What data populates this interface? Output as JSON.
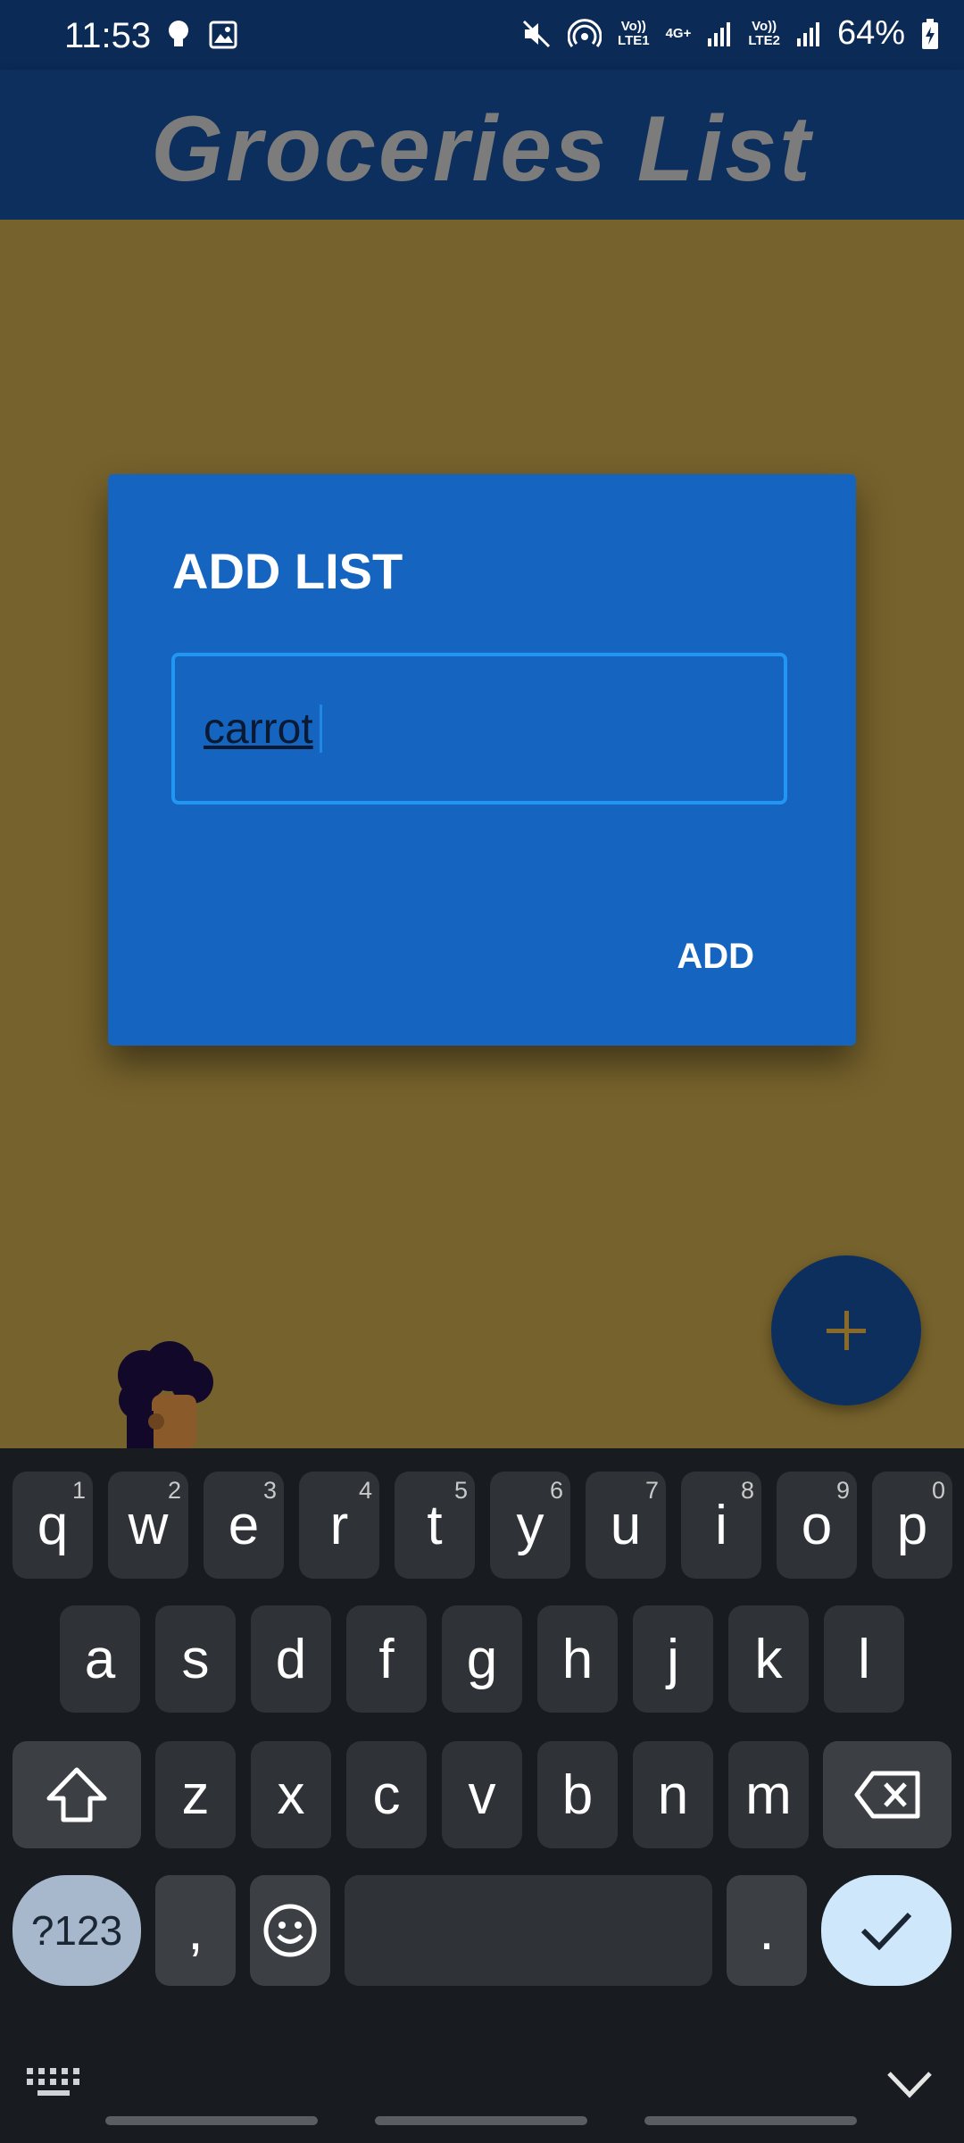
{
  "status_bar": {
    "time": "11:53",
    "net1_top": "Vo))",
    "net1_bottom": "LTE1",
    "net_type": "4G+",
    "net2_top": "Vo))",
    "net2_bottom": "LTE2",
    "battery": "64%"
  },
  "app": {
    "title": "Groceries List"
  },
  "dialog": {
    "title": "ADD LIST",
    "input_value": "carrot",
    "action_label": "ADD"
  },
  "keyboard": {
    "row1": [
      {
        "k": "q",
        "n": "1"
      },
      {
        "k": "w",
        "n": "2"
      },
      {
        "k": "e",
        "n": "3"
      },
      {
        "k": "r",
        "n": "4"
      },
      {
        "k": "t",
        "n": "5"
      },
      {
        "k": "y",
        "n": "6"
      },
      {
        "k": "u",
        "n": "7"
      },
      {
        "k": "i",
        "n": "8"
      },
      {
        "k": "o",
        "n": "9"
      },
      {
        "k": "p",
        "n": "0"
      }
    ],
    "row2": [
      "a",
      "s",
      "d",
      "f",
      "g",
      "h",
      "j",
      "k",
      "l"
    ],
    "row3": [
      "z",
      "x",
      "c",
      "v",
      "b",
      "n",
      "m"
    ],
    "symbols_label": "?123",
    "comma": ",",
    "period": "."
  },
  "colors": {
    "status_bar": "#0b2a55",
    "app_bar": "#0d2f5e",
    "dialog": "#1565c0",
    "field_border": "#2196f3",
    "content_scrim": "#76622c",
    "keyboard_bg": "#181b1f"
  },
  "icons": [
    "mute-icon",
    "hotspot-icon",
    "signal-icon",
    "battery-charging-icon",
    "plus-icon",
    "shift-icon",
    "backspace-icon",
    "emoji-icon",
    "check-icon",
    "keyboard-icon",
    "chevron-down-icon"
  ]
}
